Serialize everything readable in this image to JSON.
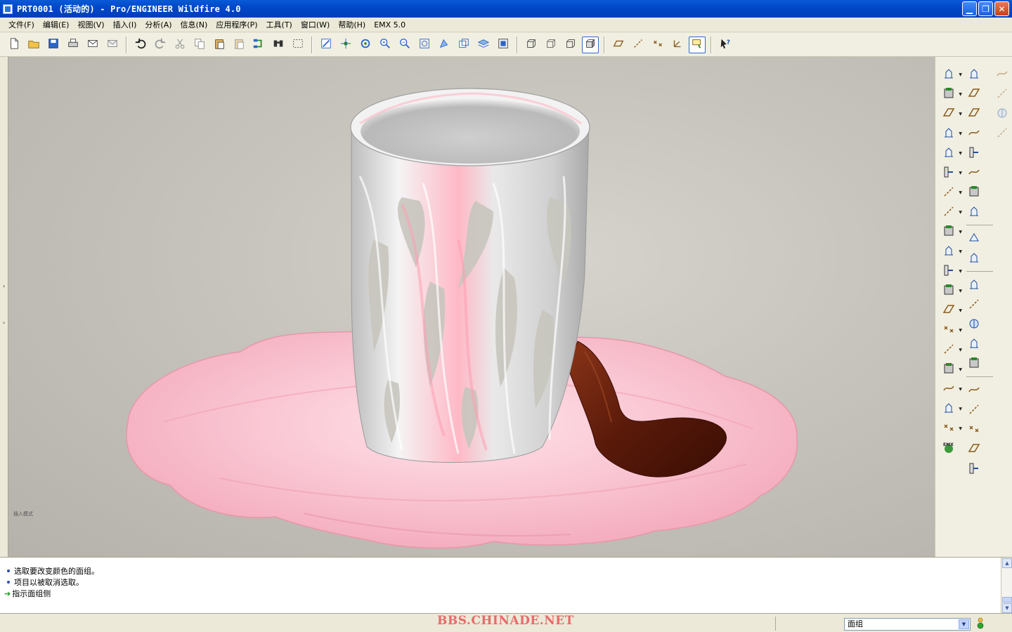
{
  "window": {
    "title": "PRT0001 (活动的) - Pro/ENGINEER Wildfire 4.0",
    "controls": [
      "minimize",
      "restore",
      "close"
    ]
  },
  "menu": [
    {
      "label": "文件(F)"
    },
    {
      "label": "编辑(E)"
    },
    {
      "label": "视图(V)"
    },
    {
      "label": "插入(I)"
    },
    {
      "label": "分析(A)"
    },
    {
      "label": "信息(N)"
    },
    {
      "label": "应用程序(P)"
    },
    {
      "label": "工具(T)"
    },
    {
      "label": "窗口(W)"
    },
    {
      "label": "帮助(H)"
    },
    {
      "label": "EMX 5.0"
    }
  ],
  "toolbar": {
    "groups": [
      [
        "new-file-icon",
        "open-folder-icon",
        "save-icon",
        "print-icon",
        "mail-icon",
        "mail-attach-icon"
      ],
      [
        "undo-icon",
        "redo-icon",
        "cut-icon",
        "copy-icon",
        "paste-icon",
        "paste-special-icon",
        "regenerate-icon",
        "find-icon",
        "select-box-icon"
      ],
      [
        "repaint-icon",
        "spin-center-icon",
        "orient-icon",
        "zoom-in-icon",
        "zoom-out-icon",
        "refit-icon",
        "reorient-icon",
        "saved-views-icon",
        "layers-icon",
        "view-manager-icon"
      ],
      [
        "wireframe-icon",
        "hidden-line-icon",
        "no-hidden-icon",
        "shading-icon"
      ],
      [
        "datum-planes-icon",
        "datum-axes-icon",
        "datum-points-icon",
        "datum-csys-icon",
        "annotations-icon"
      ],
      [
        "whats-this-icon"
      ]
    ],
    "active": [
      "shading-icon",
      "annotations-icon"
    ]
  },
  "viewport": {
    "mode_label": "插入模式",
    "model": {
      "cup_color": "#e8e8e8",
      "saucer_color": "#f7b9c8",
      "spoon_color": "#6b2210",
      "highlight_color": "#ff8aa0"
    }
  },
  "right_toolbar": {
    "col1": [
      "hole-icon",
      "shell-icon",
      "rib-icon",
      "draft-icon",
      "round-icon",
      "chamfer-icon",
      "edge-round-icon",
      "extrude-icon",
      "revolve-icon",
      "variable-sweep-icon",
      "blend-icon",
      "swept-blend-icon",
      "helical-sweep-icon",
      "boundary-blend-icon",
      "style-icon",
      "offset-icon",
      "thicken-icon",
      "solidify-icon",
      "merge-icon",
      "emx-icon"
    ],
    "col2": [
      "sketch-icon",
      "plane-icon",
      "axis-icon",
      "curve-icon",
      "point-icon",
      "csys-icon",
      "analysis-icon",
      "chain-icon",
      "copy-feature-icon",
      "paste-feature-icon",
      "trim-icon",
      "extend-icon",
      "intersect-icon",
      "project-icon",
      "wrap-icon",
      "pattern-icon",
      "mirror-icon",
      "move-icon",
      "flatten-icon",
      "warp-icon"
    ],
    "col3": [
      "datum-graph-icon",
      "cosmetic-sketch-icon",
      "cosmetic-thread-icon",
      "cosmetic-groove-icon"
    ]
  },
  "messages": [
    {
      "type": "info",
      "text": "选取要改变颜色的面组。"
    },
    {
      "type": "info",
      "text": "项目以被取消选取。"
    },
    {
      "type": "prompt",
      "text": "指示面组侧"
    }
  ],
  "status": {
    "watermark": "BBS.CHINADE.NET",
    "filter_value": "面组",
    "light_color": "#2aa52a"
  }
}
